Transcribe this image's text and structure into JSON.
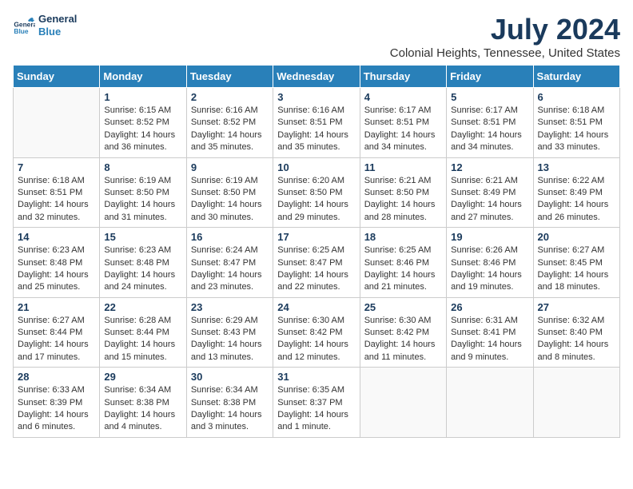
{
  "header": {
    "logo_line1": "General",
    "logo_line2": "Blue",
    "title": "July 2024",
    "subtitle": "Colonial Heights, Tennessee, United States"
  },
  "days_of_week": [
    "Sunday",
    "Monday",
    "Tuesday",
    "Wednesday",
    "Thursday",
    "Friday",
    "Saturday"
  ],
  "weeks": [
    [
      {
        "day": "",
        "lines": []
      },
      {
        "day": "1",
        "lines": [
          "Sunrise: 6:15 AM",
          "Sunset: 8:52 PM",
          "Daylight: 14 hours",
          "and 36 minutes."
        ]
      },
      {
        "day": "2",
        "lines": [
          "Sunrise: 6:16 AM",
          "Sunset: 8:52 PM",
          "Daylight: 14 hours",
          "and 35 minutes."
        ]
      },
      {
        "day": "3",
        "lines": [
          "Sunrise: 6:16 AM",
          "Sunset: 8:51 PM",
          "Daylight: 14 hours",
          "and 35 minutes."
        ]
      },
      {
        "day": "4",
        "lines": [
          "Sunrise: 6:17 AM",
          "Sunset: 8:51 PM",
          "Daylight: 14 hours",
          "and 34 minutes."
        ]
      },
      {
        "day": "5",
        "lines": [
          "Sunrise: 6:17 AM",
          "Sunset: 8:51 PM",
          "Daylight: 14 hours",
          "and 34 minutes."
        ]
      },
      {
        "day": "6",
        "lines": [
          "Sunrise: 6:18 AM",
          "Sunset: 8:51 PM",
          "Daylight: 14 hours",
          "and 33 minutes."
        ]
      }
    ],
    [
      {
        "day": "7",
        "lines": [
          "Sunrise: 6:18 AM",
          "Sunset: 8:51 PM",
          "Daylight: 14 hours",
          "and 32 minutes."
        ]
      },
      {
        "day": "8",
        "lines": [
          "Sunrise: 6:19 AM",
          "Sunset: 8:50 PM",
          "Daylight: 14 hours",
          "and 31 minutes."
        ]
      },
      {
        "day": "9",
        "lines": [
          "Sunrise: 6:19 AM",
          "Sunset: 8:50 PM",
          "Daylight: 14 hours",
          "and 30 minutes."
        ]
      },
      {
        "day": "10",
        "lines": [
          "Sunrise: 6:20 AM",
          "Sunset: 8:50 PM",
          "Daylight: 14 hours",
          "and 29 minutes."
        ]
      },
      {
        "day": "11",
        "lines": [
          "Sunrise: 6:21 AM",
          "Sunset: 8:50 PM",
          "Daylight: 14 hours",
          "and 28 minutes."
        ]
      },
      {
        "day": "12",
        "lines": [
          "Sunrise: 6:21 AM",
          "Sunset: 8:49 PM",
          "Daylight: 14 hours",
          "and 27 minutes."
        ]
      },
      {
        "day": "13",
        "lines": [
          "Sunrise: 6:22 AM",
          "Sunset: 8:49 PM",
          "Daylight: 14 hours",
          "and 26 minutes."
        ]
      }
    ],
    [
      {
        "day": "14",
        "lines": [
          "Sunrise: 6:23 AM",
          "Sunset: 8:48 PM",
          "Daylight: 14 hours",
          "and 25 minutes."
        ]
      },
      {
        "day": "15",
        "lines": [
          "Sunrise: 6:23 AM",
          "Sunset: 8:48 PM",
          "Daylight: 14 hours",
          "and 24 minutes."
        ]
      },
      {
        "day": "16",
        "lines": [
          "Sunrise: 6:24 AM",
          "Sunset: 8:47 PM",
          "Daylight: 14 hours",
          "and 23 minutes."
        ]
      },
      {
        "day": "17",
        "lines": [
          "Sunrise: 6:25 AM",
          "Sunset: 8:47 PM",
          "Daylight: 14 hours",
          "and 22 minutes."
        ]
      },
      {
        "day": "18",
        "lines": [
          "Sunrise: 6:25 AM",
          "Sunset: 8:46 PM",
          "Daylight: 14 hours",
          "and 21 minutes."
        ]
      },
      {
        "day": "19",
        "lines": [
          "Sunrise: 6:26 AM",
          "Sunset: 8:46 PM",
          "Daylight: 14 hours",
          "and 19 minutes."
        ]
      },
      {
        "day": "20",
        "lines": [
          "Sunrise: 6:27 AM",
          "Sunset: 8:45 PM",
          "Daylight: 14 hours",
          "and 18 minutes."
        ]
      }
    ],
    [
      {
        "day": "21",
        "lines": [
          "Sunrise: 6:27 AM",
          "Sunset: 8:44 PM",
          "Daylight: 14 hours",
          "and 17 minutes."
        ]
      },
      {
        "day": "22",
        "lines": [
          "Sunrise: 6:28 AM",
          "Sunset: 8:44 PM",
          "Daylight: 14 hours",
          "and 15 minutes."
        ]
      },
      {
        "day": "23",
        "lines": [
          "Sunrise: 6:29 AM",
          "Sunset: 8:43 PM",
          "Daylight: 14 hours",
          "and 13 minutes."
        ]
      },
      {
        "day": "24",
        "lines": [
          "Sunrise: 6:30 AM",
          "Sunset: 8:42 PM",
          "Daylight: 14 hours",
          "and 12 minutes."
        ]
      },
      {
        "day": "25",
        "lines": [
          "Sunrise: 6:30 AM",
          "Sunset: 8:42 PM",
          "Daylight: 14 hours",
          "and 11 minutes."
        ]
      },
      {
        "day": "26",
        "lines": [
          "Sunrise: 6:31 AM",
          "Sunset: 8:41 PM",
          "Daylight: 14 hours",
          "and 9 minutes."
        ]
      },
      {
        "day": "27",
        "lines": [
          "Sunrise: 6:32 AM",
          "Sunset: 8:40 PM",
          "Daylight: 14 hours",
          "and 8 minutes."
        ]
      }
    ],
    [
      {
        "day": "28",
        "lines": [
          "Sunrise: 6:33 AM",
          "Sunset: 8:39 PM",
          "Daylight: 14 hours",
          "and 6 minutes."
        ]
      },
      {
        "day": "29",
        "lines": [
          "Sunrise: 6:34 AM",
          "Sunset: 8:38 PM",
          "Daylight: 14 hours",
          "and 4 minutes."
        ]
      },
      {
        "day": "30",
        "lines": [
          "Sunrise: 6:34 AM",
          "Sunset: 8:38 PM",
          "Daylight: 14 hours",
          "and 3 minutes."
        ]
      },
      {
        "day": "31",
        "lines": [
          "Sunrise: 6:35 AM",
          "Sunset: 8:37 PM",
          "Daylight: 14 hours",
          "and 1 minute."
        ]
      },
      {
        "day": "",
        "lines": []
      },
      {
        "day": "",
        "lines": []
      },
      {
        "day": "",
        "lines": []
      }
    ]
  ]
}
